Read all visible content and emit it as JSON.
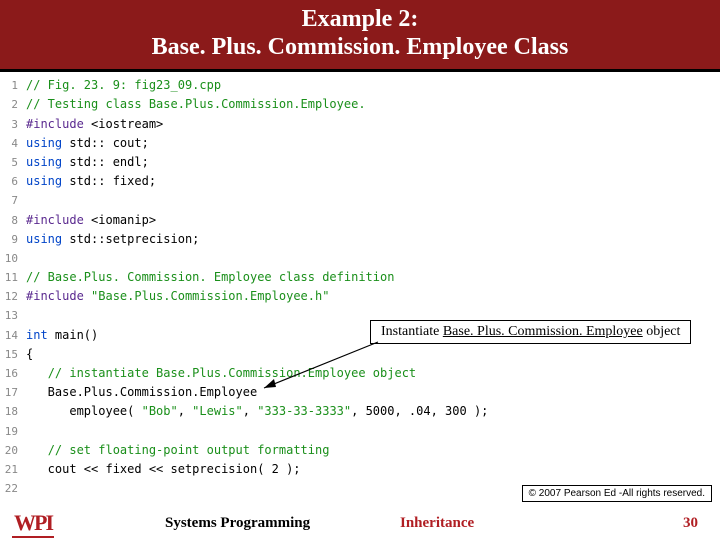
{
  "header": {
    "line1": "Example 2:",
    "line2": "Base. Plus. Commission. Employee Class"
  },
  "code": {
    "lines": [
      {
        "n": "1",
        "tokens": [
          {
            "c": "tok-comment",
            "t": "// Fig. 23. 9: fig23_09.cpp"
          }
        ]
      },
      {
        "n": "2",
        "tokens": [
          {
            "c": "tok-comment",
            "t": "// Testing class Base.Plus.Commission.Employee."
          }
        ]
      },
      {
        "n": "3",
        "tokens": [
          {
            "c": "tok-pre",
            "t": "#include"
          },
          {
            "c": "",
            "t": " <iostream>"
          }
        ]
      },
      {
        "n": "4",
        "tokens": [
          {
            "c": "tok-kw",
            "t": "using"
          },
          {
            "c": "",
            "t": " std:: cout;"
          }
        ]
      },
      {
        "n": "5",
        "tokens": [
          {
            "c": "tok-kw",
            "t": "using"
          },
          {
            "c": "",
            "t": " std:: endl;"
          }
        ]
      },
      {
        "n": "6",
        "tokens": [
          {
            "c": "tok-kw",
            "t": "using"
          },
          {
            "c": "",
            "t": " std:: fixed;"
          }
        ]
      },
      {
        "n": "7",
        "tokens": []
      },
      {
        "n": "8",
        "tokens": [
          {
            "c": "tok-pre",
            "t": "#include"
          },
          {
            "c": "",
            "t": " <iomanip>"
          }
        ]
      },
      {
        "n": "9",
        "tokens": [
          {
            "c": "tok-kw",
            "t": "using"
          },
          {
            "c": "",
            "t": " std::setprecision;"
          }
        ]
      },
      {
        "n": "10",
        "tokens": []
      },
      {
        "n": "11",
        "tokens": [
          {
            "c": "tok-comment",
            "t": "// Base.Plus. Commission. Employee class definition"
          }
        ]
      },
      {
        "n": "12",
        "tokens": [
          {
            "c": "tok-pre",
            "t": "#include"
          },
          {
            "c": "",
            "t": " "
          },
          {
            "c": "tok-str",
            "t": "\"Base.Plus.Commission.Employee.h\""
          }
        ]
      },
      {
        "n": "13",
        "tokens": []
      },
      {
        "n": "14",
        "tokens": [
          {
            "c": "tok-kw",
            "t": "int"
          },
          {
            "c": "",
            "t": " main()"
          }
        ]
      },
      {
        "n": "15",
        "tokens": [
          {
            "c": "",
            "t": "{"
          }
        ]
      },
      {
        "n": "16",
        "tokens": [
          {
            "c": "",
            "t": "   "
          },
          {
            "c": "tok-comment",
            "t": "// instantiate Base.Plus.Commission.Employee object"
          }
        ]
      },
      {
        "n": "17",
        "tokens": [
          {
            "c": "",
            "t": "   Base.Plus.Commission.Employee"
          }
        ]
      },
      {
        "n": "18",
        "tokens": [
          {
            "c": "",
            "t": "      employee( "
          },
          {
            "c": "tok-str",
            "t": "\"Bob\""
          },
          {
            "c": "",
            "t": ", "
          },
          {
            "c": "tok-str",
            "t": "\"Lewis\""
          },
          {
            "c": "",
            "t": ", "
          },
          {
            "c": "tok-str",
            "t": "\"333-33-3333\""
          },
          {
            "c": "",
            "t": ", 5000, .04, 300 );"
          }
        ]
      },
      {
        "n": "19",
        "tokens": []
      },
      {
        "n": "20",
        "tokens": [
          {
            "c": "",
            "t": "   "
          },
          {
            "c": "tok-comment",
            "t": "// set floating-point output formatting"
          }
        ]
      },
      {
        "n": "21",
        "tokens": [
          {
            "c": "",
            "t": "   cout << fixed << setprecision( 2 );"
          }
        ]
      },
      {
        "n": "22",
        "tokens": []
      }
    ]
  },
  "callout": {
    "pre": "Instantiate ",
    "underlined": "Base. Plus. Commission. Employee",
    "post": " object"
  },
  "copyright": "© 2007 Pearson Ed -All rights reserved.",
  "footer": {
    "logo": "WPI",
    "left": "Systems Programming",
    "mid": "Inheritance",
    "right": "30"
  }
}
